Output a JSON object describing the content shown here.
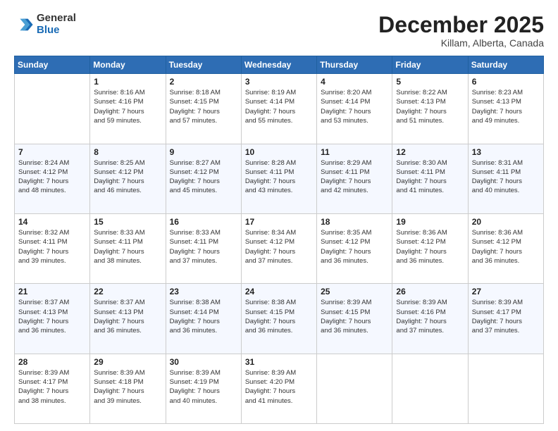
{
  "header": {
    "logo": {
      "general": "General",
      "blue": "Blue"
    },
    "title": "December 2025",
    "subtitle": "Killam, Alberta, Canada"
  },
  "calendar": {
    "days_of_week": [
      "Sunday",
      "Monday",
      "Tuesday",
      "Wednesday",
      "Thursday",
      "Friday",
      "Saturday"
    ],
    "weeks": [
      [
        {
          "day": "",
          "info": ""
        },
        {
          "day": "1",
          "info": "Sunrise: 8:16 AM\nSunset: 4:16 PM\nDaylight: 7 hours\nand 59 minutes."
        },
        {
          "day": "2",
          "info": "Sunrise: 8:18 AM\nSunset: 4:15 PM\nDaylight: 7 hours\nand 57 minutes."
        },
        {
          "day": "3",
          "info": "Sunrise: 8:19 AM\nSunset: 4:14 PM\nDaylight: 7 hours\nand 55 minutes."
        },
        {
          "day": "4",
          "info": "Sunrise: 8:20 AM\nSunset: 4:14 PM\nDaylight: 7 hours\nand 53 minutes."
        },
        {
          "day": "5",
          "info": "Sunrise: 8:22 AM\nSunset: 4:13 PM\nDaylight: 7 hours\nand 51 minutes."
        },
        {
          "day": "6",
          "info": "Sunrise: 8:23 AM\nSunset: 4:13 PM\nDaylight: 7 hours\nand 49 minutes."
        }
      ],
      [
        {
          "day": "7",
          "info": "Sunrise: 8:24 AM\nSunset: 4:12 PM\nDaylight: 7 hours\nand 48 minutes."
        },
        {
          "day": "8",
          "info": "Sunrise: 8:25 AM\nSunset: 4:12 PM\nDaylight: 7 hours\nand 46 minutes."
        },
        {
          "day": "9",
          "info": "Sunrise: 8:27 AM\nSunset: 4:12 PM\nDaylight: 7 hours\nand 45 minutes."
        },
        {
          "day": "10",
          "info": "Sunrise: 8:28 AM\nSunset: 4:11 PM\nDaylight: 7 hours\nand 43 minutes."
        },
        {
          "day": "11",
          "info": "Sunrise: 8:29 AM\nSunset: 4:11 PM\nDaylight: 7 hours\nand 42 minutes."
        },
        {
          "day": "12",
          "info": "Sunrise: 8:30 AM\nSunset: 4:11 PM\nDaylight: 7 hours\nand 41 minutes."
        },
        {
          "day": "13",
          "info": "Sunrise: 8:31 AM\nSunset: 4:11 PM\nDaylight: 7 hours\nand 40 minutes."
        }
      ],
      [
        {
          "day": "14",
          "info": "Sunrise: 8:32 AM\nSunset: 4:11 PM\nDaylight: 7 hours\nand 39 minutes."
        },
        {
          "day": "15",
          "info": "Sunrise: 8:33 AM\nSunset: 4:11 PM\nDaylight: 7 hours\nand 38 minutes."
        },
        {
          "day": "16",
          "info": "Sunrise: 8:33 AM\nSunset: 4:11 PM\nDaylight: 7 hours\nand 37 minutes."
        },
        {
          "day": "17",
          "info": "Sunrise: 8:34 AM\nSunset: 4:12 PM\nDaylight: 7 hours\nand 37 minutes."
        },
        {
          "day": "18",
          "info": "Sunrise: 8:35 AM\nSunset: 4:12 PM\nDaylight: 7 hours\nand 36 minutes."
        },
        {
          "day": "19",
          "info": "Sunrise: 8:36 AM\nSunset: 4:12 PM\nDaylight: 7 hours\nand 36 minutes."
        },
        {
          "day": "20",
          "info": "Sunrise: 8:36 AM\nSunset: 4:12 PM\nDaylight: 7 hours\nand 36 minutes."
        }
      ],
      [
        {
          "day": "21",
          "info": "Sunrise: 8:37 AM\nSunset: 4:13 PM\nDaylight: 7 hours\nand 36 minutes."
        },
        {
          "day": "22",
          "info": "Sunrise: 8:37 AM\nSunset: 4:13 PM\nDaylight: 7 hours\nand 36 minutes."
        },
        {
          "day": "23",
          "info": "Sunrise: 8:38 AM\nSunset: 4:14 PM\nDaylight: 7 hours\nand 36 minutes."
        },
        {
          "day": "24",
          "info": "Sunrise: 8:38 AM\nSunset: 4:15 PM\nDaylight: 7 hours\nand 36 minutes."
        },
        {
          "day": "25",
          "info": "Sunrise: 8:39 AM\nSunset: 4:15 PM\nDaylight: 7 hours\nand 36 minutes."
        },
        {
          "day": "26",
          "info": "Sunrise: 8:39 AM\nSunset: 4:16 PM\nDaylight: 7 hours\nand 37 minutes."
        },
        {
          "day": "27",
          "info": "Sunrise: 8:39 AM\nSunset: 4:17 PM\nDaylight: 7 hours\nand 37 minutes."
        }
      ],
      [
        {
          "day": "28",
          "info": "Sunrise: 8:39 AM\nSunset: 4:17 PM\nDaylight: 7 hours\nand 38 minutes."
        },
        {
          "day": "29",
          "info": "Sunrise: 8:39 AM\nSunset: 4:18 PM\nDaylight: 7 hours\nand 39 minutes."
        },
        {
          "day": "30",
          "info": "Sunrise: 8:39 AM\nSunset: 4:19 PM\nDaylight: 7 hours\nand 40 minutes."
        },
        {
          "day": "31",
          "info": "Sunrise: 8:39 AM\nSunset: 4:20 PM\nDaylight: 7 hours\nand 41 minutes."
        },
        {
          "day": "",
          "info": ""
        },
        {
          "day": "",
          "info": ""
        },
        {
          "day": "",
          "info": ""
        }
      ]
    ]
  }
}
